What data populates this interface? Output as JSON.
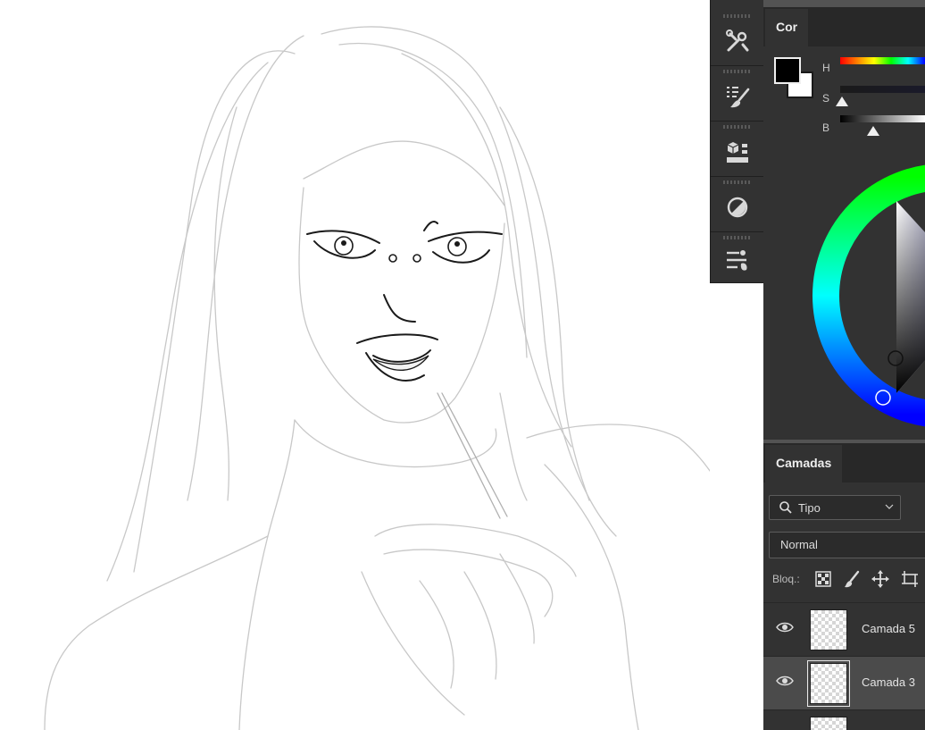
{
  "canvas": {
    "description_icon": "pencil-sketch"
  },
  "toolstrip": {
    "collapse_glyph": "«",
    "tools": [
      {
        "icon": "brush-tools-icon"
      },
      {
        "icon": "brush-settings-icon"
      },
      {
        "icon": "3d-materials-icon"
      },
      {
        "icon": "adjustments-icon"
      },
      {
        "icon": "tool-presets-icon"
      }
    ]
  },
  "color_panel": {
    "tab_label": "Cor",
    "foreground": "#000000",
    "background": "#ffffff",
    "sliders": [
      {
        "label": "H"
      },
      {
        "label": "S"
      },
      {
        "label": "B"
      }
    ]
  },
  "layers_panel": {
    "tab_label": "Camadas",
    "filter_label": "Tipo",
    "blend_mode": "Normal",
    "lock_label": "Bloq.:",
    "layers": [
      {
        "name": "Camada 5",
        "active": false
      },
      {
        "name": "Camada 3",
        "active": true
      }
    ]
  },
  "colors": {
    "panel_bg": "#323232",
    "tabbar_bg": "#282828",
    "active_row": "#4b4b4b"
  }
}
